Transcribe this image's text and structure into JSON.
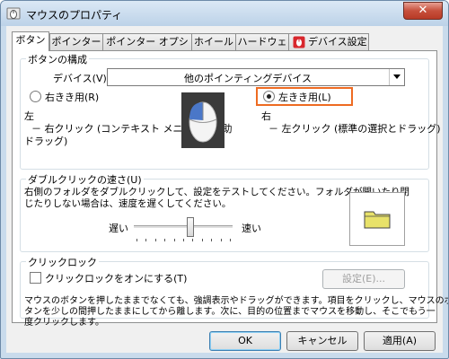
{
  "window": {
    "title": "マウスのプロパティ",
    "close_label": "✕"
  },
  "tabs": [
    {
      "label": "ボタン"
    },
    {
      "label": "ポインター"
    },
    {
      "label": "ポインター オプション"
    },
    {
      "label": "ホイール"
    },
    {
      "label": "ハードウェア"
    },
    {
      "label": "デバイス設定"
    }
  ],
  "button_config": {
    "group_title": "ボタンの構成",
    "device_label": "デバイス(V):",
    "device_value": "他のポインティングデバイス",
    "right_hand_label": "右きき用(R)",
    "left_hand_label": "左きき用(L)",
    "left_hand_selected": true,
    "left_desc_title": "左",
    "left_desc_line1": "－ 右クリック (コンテキスト メニューと補助",
    "left_desc_line2": "ドラッグ)",
    "right_desc_title": "右",
    "right_desc_line1": "－ 左クリック (標準の選択とドラッグ)"
  },
  "double_click": {
    "group_title": "ダブルクリックの速さ(U)",
    "line1": "右側のフォルダをダブルクリックして、設定をテストしてください。フォルダが開いたり閉",
    "line2": "じたりしない場合は、速度を遅くしてください。",
    "slow_label": "遅い",
    "fast_label": "速い",
    "speed_fraction": 0.58
  },
  "click_lock": {
    "group_title": "クリックロック",
    "checkbox_label": "クリックロックをオンにする(T)",
    "checked": false,
    "settings_label": "設定(E)...",
    "line1": "マウスのボタンを押したままでなくても、強調表示やドラッグができます。項目をクリックし、マウスのボ",
    "line2": "タンを少しの間押したままにしてから離します。次に、目的の位置までマウスを移動し、そこでもう一",
    "line3": "度クリックします。"
  },
  "footer": {
    "ok_label": "OK",
    "cancel_label": "キャンセル",
    "apply_label": "適用(A)"
  },
  "colors": {
    "highlight": "#ee6b22",
    "close_button": "#c7503c",
    "folder": "#e8e26a"
  }
}
